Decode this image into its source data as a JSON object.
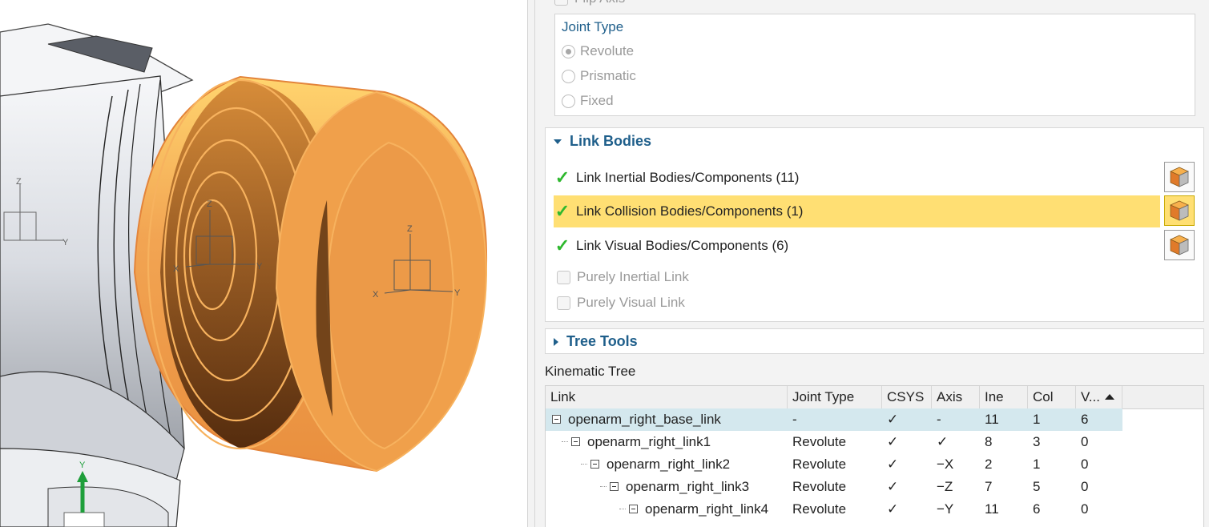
{
  "joint_options": {
    "flip_axis_label": "Flip Axis",
    "joint_type": {
      "title": "Joint Type",
      "options": [
        {
          "label": "Revolute",
          "selected": true
        },
        {
          "label": "Prismatic",
          "selected": false
        },
        {
          "label": "Fixed",
          "selected": false
        }
      ]
    }
  },
  "link_bodies": {
    "title": "Link Bodies",
    "rows": [
      {
        "label": "Link Inertial Bodies/Components (11)",
        "highlighted": false
      },
      {
        "label": "Link Collision Bodies/Components (1)",
        "highlighted": true
      },
      {
        "label": "Link Visual Bodies/Components (6)",
        "highlighted": false
      }
    ],
    "purely_inertial_label": "Purely Inertial Link",
    "purely_visual_label": "Purely Visual Link"
  },
  "tree_tools": {
    "title": "Tree Tools"
  },
  "kinematic_tree": {
    "label": "Kinematic Tree",
    "columns": [
      "Link",
      "Joint Type",
      "CSYS",
      "Axis",
      "Ine",
      "Col",
      "V..."
    ],
    "rows": [
      {
        "link": "openarm_right_base_link",
        "joint_type": "-",
        "csys": "✓",
        "axis": "-",
        "ine": "11",
        "col": "1",
        "v": "6",
        "selected": true
      },
      {
        "link": "openarm_right_link1",
        "joint_type": "Revolute",
        "csys": "✓",
        "axis": "✓",
        "ine": "8",
        "col": "3",
        "v": "0"
      },
      {
        "link": "openarm_right_link2",
        "joint_type": "Revolute",
        "csys": "✓",
        "axis": "−X",
        "ine": "2",
        "col": "1",
        "v": "0"
      },
      {
        "link": "openarm_right_link3",
        "joint_type": "Revolute",
        "csys": "✓",
        "axis": "−Z",
        "ine": "7",
        "col": "5",
        "v": "0"
      },
      {
        "link": "openarm_right_link4",
        "joint_type": "Revolute",
        "csys": "✓",
        "axis": "−Y",
        "ine": "11",
        "col": "6",
        "v": "0"
      }
    ]
  },
  "viewport": {
    "axis_labels": {
      "x": "X",
      "y": "Y",
      "z": "Z"
    },
    "highlight_color": "#f0a04b",
    "model_color": "#e6e8ec"
  }
}
